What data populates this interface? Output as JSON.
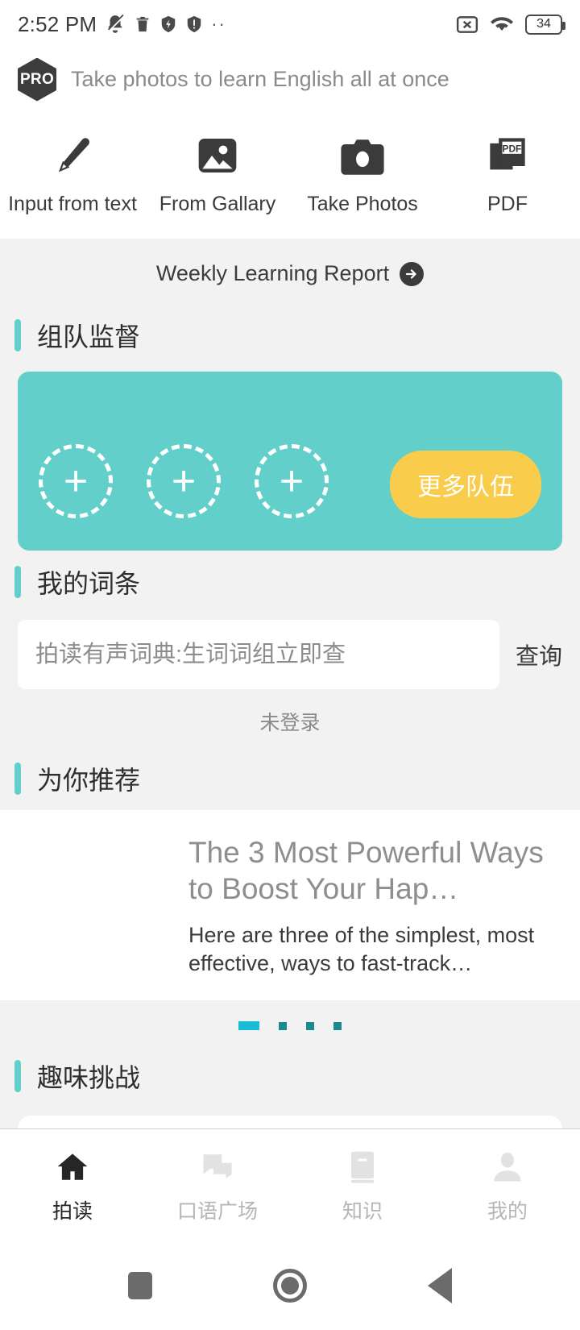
{
  "status_bar": {
    "time": "2:52 PM",
    "left_icons": [
      "bell-muted-icon",
      "trash-icon",
      "shield-flash-icon",
      "shield-alert-icon",
      "more-dots-icon"
    ],
    "right_icons": [
      "sim-off-icon",
      "wifi-icon"
    ],
    "battery_level": "34"
  },
  "pro_header": {
    "badge": "PRO",
    "tagline": "Take photos to learn English all at once"
  },
  "quick_actions": [
    {
      "icon": "pencil-icon",
      "label": "Input from text"
    },
    {
      "icon": "image-icon",
      "label": "From Gallary"
    },
    {
      "icon": "camera-icon",
      "label": "Take Photos"
    },
    {
      "icon": "pdf-icon",
      "label": "PDF"
    }
  ],
  "weekly_report": {
    "label": "Weekly Learning Report",
    "arrow_icon": "arrow-right-circle-icon"
  },
  "team_section": {
    "title": "组队监督",
    "slots": [
      "add-team-slot",
      "add-team-slot",
      "add-team-slot"
    ],
    "more_button": "更多队伍",
    "card_color": "#62cfcb",
    "button_color": "#f9cd4b"
  },
  "entries_section": {
    "title": "我的词条",
    "search_placeholder": "拍读有声词典:生词词组立即查",
    "search_value": "",
    "query_button": "查询",
    "login_state": "未登录"
  },
  "recommend_section": {
    "title": "为你推荐",
    "article": {
      "title": "The 3 Most Powerful Ways to Boost Your Hap…",
      "description": "Here are three of the simplest, most effective, ways to fast-track…"
    },
    "pagination": {
      "total": 4,
      "active_index": 0,
      "active_color": "#16bdd4",
      "inactive_color": "#1a8a90"
    }
  },
  "challenge_section": {
    "title": "趣味挑战"
  },
  "tab_bar": [
    {
      "icon": "home-icon",
      "label": "拍读",
      "active": true
    },
    {
      "icon": "chat-icon",
      "label": "口语广场",
      "active": false
    },
    {
      "icon": "book-icon",
      "label": "知识",
      "active": false
    },
    {
      "icon": "person-icon",
      "label": "我的",
      "active": false
    }
  ],
  "nav_bar": [
    {
      "icon": "recents-square-icon"
    },
    {
      "icon": "home-circle-icon"
    },
    {
      "icon": "back-triangle-icon"
    }
  ],
  "theme": {
    "accent": "#62cfcb",
    "page_bg": "#f2f2f2",
    "card_bg": "#ffffff"
  }
}
